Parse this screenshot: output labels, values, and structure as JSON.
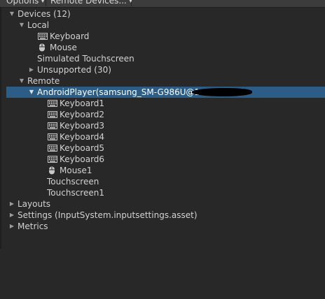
{
  "toolbar": {
    "options_label": "Options",
    "remote_devices_label": "Remote Devices..."
  },
  "tree": {
    "devices": {
      "label": "Devices (12)",
      "expanded": true
    },
    "local": {
      "label": "Local",
      "expanded": true
    },
    "local_keyboard": {
      "label": "Keyboard",
      "icon": "keyboard-icon"
    },
    "local_mouse": {
      "label": "Mouse",
      "icon": "mouse-icon"
    },
    "simulated_touchscreen": {
      "label": "Simulated Touchscreen"
    },
    "unsupported": {
      "label": "Unsupported (30)",
      "expanded": false
    },
    "remote": {
      "label": "Remote",
      "expanded": true
    },
    "android_player": {
      "label": "AndroidPlayer(samsung_SM-G986U@1",
      "expanded": true,
      "selected": true
    },
    "remote_keyboard1": {
      "label": "Keyboard1",
      "icon": "keyboard-icon"
    },
    "remote_keyboard2": {
      "label": "Keyboard2",
      "icon": "keyboard-icon"
    },
    "remote_keyboard3": {
      "label": "Keyboard3",
      "icon": "keyboard-icon"
    },
    "remote_keyboard4": {
      "label": "Keyboard4",
      "icon": "keyboard-icon"
    },
    "remote_keyboard5": {
      "label": "Keyboard5",
      "icon": "keyboard-icon"
    },
    "remote_keyboard6": {
      "label": "Keyboard6",
      "icon": "keyboard-icon"
    },
    "remote_mouse1": {
      "label": "Mouse1",
      "icon": "mouse-icon"
    },
    "remote_touchscreen": {
      "label": "Touchscreen"
    },
    "remote_touchscreen1": {
      "label": "Touchscreen1"
    },
    "layouts": {
      "label": "Layouts",
      "expanded": false
    },
    "settings": {
      "label": "Settings (InputSystem.inputsettings.asset)",
      "expanded": false
    },
    "metrics": {
      "label": "Metrics",
      "expanded": false
    }
  },
  "colors": {
    "background": "#282828",
    "selection": "#2c5d87",
    "text": "#d2d2d2"
  }
}
